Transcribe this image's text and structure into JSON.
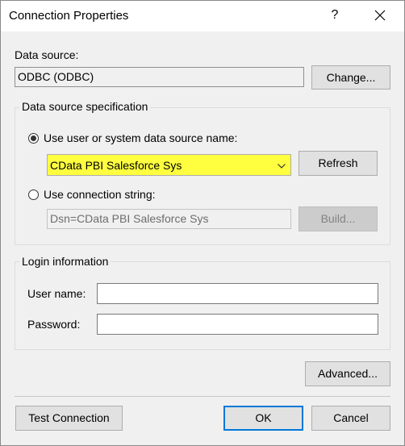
{
  "window": {
    "title": "Connection Properties",
    "help_label": "?"
  },
  "data_source": {
    "label": "Data source:",
    "value": "ODBC (ODBC)",
    "change_button": "Change..."
  },
  "spec_group": {
    "title": "Data source specification",
    "use_dsn_label": "Use user or system data source name:",
    "dsn_selected": "CData PBI Salesforce Sys",
    "refresh_button": "Refresh",
    "use_conn_string_label": "Use connection string:",
    "conn_string_value": "Dsn=CData PBI Salesforce Sys",
    "build_button": "Build..."
  },
  "login_group": {
    "title": "Login information",
    "username_label": "User name:",
    "username_value": "",
    "password_label": "Password:",
    "password_value": ""
  },
  "buttons": {
    "advanced": "Advanced...",
    "test_connection": "Test Connection",
    "ok": "OK",
    "cancel": "Cancel"
  },
  "colors": {
    "highlight": "#ffff40",
    "default_button_border": "#0078d7"
  }
}
